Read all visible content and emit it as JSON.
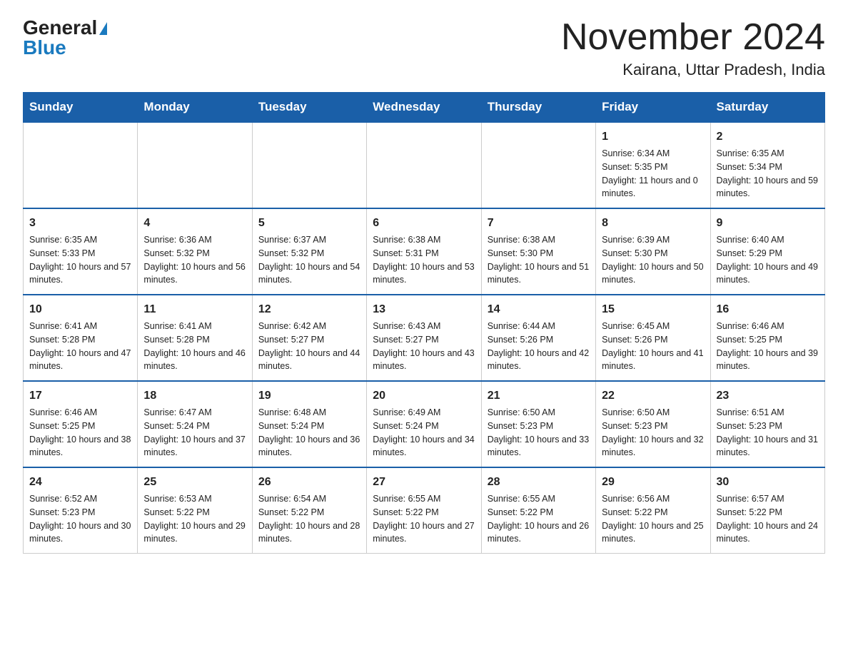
{
  "header": {
    "logo_general": "General",
    "logo_blue": "Blue",
    "month_title": "November 2024",
    "location": "Kairana, Uttar Pradesh, India"
  },
  "days_of_week": [
    "Sunday",
    "Monday",
    "Tuesday",
    "Wednesday",
    "Thursday",
    "Friday",
    "Saturday"
  ],
  "weeks": [
    [
      {
        "day": "",
        "info": ""
      },
      {
        "day": "",
        "info": ""
      },
      {
        "day": "",
        "info": ""
      },
      {
        "day": "",
        "info": ""
      },
      {
        "day": "",
        "info": ""
      },
      {
        "day": "1",
        "info": "Sunrise: 6:34 AM\nSunset: 5:35 PM\nDaylight: 11 hours and 0 minutes."
      },
      {
        "day": "2",
        "info": "Sunrise: 6:35 AM\nSunset: 5:34 PM\nDaylight: 10 hours and 59 minutes."
      }
    ],
    [
      {
        "day": "3",
        "info": "Sunrise: 6:35 AM\nSunset: 5:33 PM\nDaylight: 10 hours and 57 minutes."
      },
      {
        "day": "4",
        "info": "Sunrise: 6:36 AM\nSunset: 5:32 PM\nDaylight: 10 hours and 56 minutes."
      },
      {
        "day": "5",
        "info": "Sunrise: 6:37 AM\nSunset: 5:32 PM\nDaylight: 10 hours and 54 minutes."
      },
      {
        "day": "6",
        "info": "Sunrise: 6:38 AM\nSunset: 5:31 PM\nDaylight: 10 hours and 53 minutes."
      },
      {
        "day": "7",
        "info": "Sunrise: 6:38 AM\nSunset: 5:30 PM\nDaylight: 10 hours and 51 minutes."
      },
      {
        "day": "8",
        "info": "Sunrise: 6:39 AM\nSunset: 5:30 PM\nDaylight: 10 hours and 50 minutes."
      },
      {
        "day": "9",
        "info": "Sunrise: 6:40 AM\nSunset: 5:29 PM\nDaylight: 10 hours and 49 minutes."
      }
    ],
    [
      {
        "day": "10",
        "info": "Sunrise: 6:41 AM\nSunset: 5:28 PM\nDaylight: 10 hours and 47 minutes."
      },
      {
        "day": "11",
        "info": "Sunrise: 6:41 AM\nSunset: 5:28 PM\nDaylight: 10 hours and 46 minutes."
      },
      {
        "day": "12",
        "info": "Sunrise: 6:42 AM\nSunset: 5:27 PM\nDaylight: 10 hours and 44 minutes."
      },
      {
        "day": "13",
        "info": "Sunrise: 6:43 AM\nSunset: 5:27 PM\nDaylight: 10 hours and 43 minutes."
      },
      {
        "day": "14",
        "info": "Sunrise: 6:44 AM\nSunset: 5:26 PM\nDaylight: 10 hours and 42 minutes."
      },
      {
        "day": "15",
        "info": "Sunrise: 6:45 AM\nSunset: 5:26 PM\nDaylight: 10 hours and 41 minutes."
      },
      {
        "day": "16",
        "info": "Sunrise: 6:46 AM\nSunset: 5:25 PM\nDaylight: 10 hours and 39 minutes."
      }
    ],
    [
      {
        "day": "17",
        "info": "Sunrise: 6:46 AM\nSunset: 5:25 PM\nDaylight: 10 hours and 38 minutes."
      },
      {
        "day": "18",
        "info": "Sunrise: 6:47 AM\nSunset: 5:24 PM\nDaylight: 10 hours and 37 minutes."
      },
      {
        "day": "19",
        "info": "Sunrise: 6:48 AM\nSunset: 5:24 PM\nDaylight: 10 hours and 36 minutes."
      },
      {
        "day": "20",
        "info": "Sunrise: 6:49 AM\nSunset: 5:24 PM\nDaylight: 10 hours and 34 minutes."
      },
      {
        "day": "21",
        "info": "Sunrise: 6:50 AM\nSunset: 5:23 PM\nDaylight: 10 hours and 33 minutes."
      },
      {
        "day": "22",
        "info": "Sunrise: 6:50 AM\nSunset: 5:23 PM\nDaylight: 10 hours and 32 minutes."
      },
      {
        "day": "23",
        "info": "Sunrise: 6:51 AM\nSunset: 5:23 PM\nDaylight: 10 hours and 31 minutes."
      }
    ],
    [
      {
        "day": "24",
        "info": "Sunrise: 6:52 AM\nSunset: 5:23 PM\nDaylight: 10 hours and 30 minutes."
      },
      {
        "day": "25",
        "info": "Sunrise: 6:53 AM\nSunset: 5:22 PM\nDaylight: 10 hours and 29 minutes."
      },
      {
        "day": "26",
        "info": "Sunrise: 6:54 AM\nSunset: 5:22 PM\nDaylight: 10 hours and 28 minutes."
      },
      {
        "day": "27",
        "info": "Sunrise: 6:55 AM\nSunset: 5:22 PM\nDaylight: 10 hours and 27 minutes."
      },
      {
        "day": "28",
        "info": "Sunrise: 6:55 AM\nSunset: 5:22 PM\nDaylight: 10 hours and 26 minutes."
      },
      {
        "day": "29",
        "info": "Sunrise: 6:56 AM\nSunset: 5:22 PM\nDaylight: 10 hours and 25 minutes."
      },
      {
        "day": "30",
        "info": "Sunrise: 6:57 AM\nSunset: 5:22 PM\nDaylight: 10 hours and 24 minutes."
      }
    ]
  ]
}
